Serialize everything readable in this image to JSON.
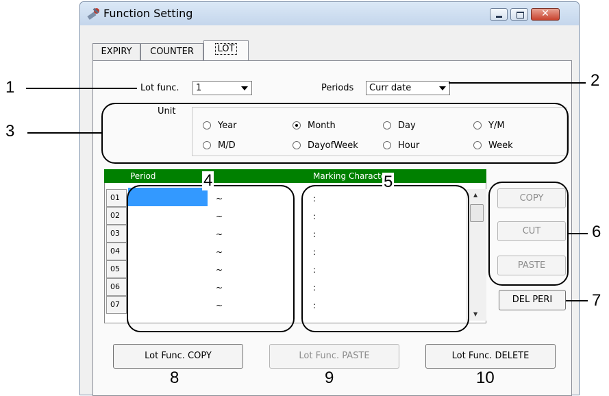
{
  "window": {
    "title": "Function Setting",
    "title_icon": "tools-icon",
    "minimize_icon": "minimize-icon",
    "maximize_icon": "maximize-icon",
    "close_icon": "close-icon",
    "close_glyph": "✕"
  },
  "tabs": [
    {
      "label": "EXPIRY"
    },
    {
      "label": "COUNTER"
    },
    {
      "label": "LOT",
      "active": true
    }
  ],
  "lot_func": {
    "label": "Lot func.",
    "value": "1"
  },
  "periods": {
    "label": "Periods",
    "value": "Curr date"
  },
  "unit": {
    "label": "Unit",
    "options": [
      {
        "label": "Year",
        "selected": false
      },
      {
        "label": "Month",
        "selected": true
      },
      {
        "label": "Day",
        "selected": false
      },
      {
        "label": "Y/M",
        "selected": false
      },
      {
        "label": "M/D",
        "selected": false
      },
      {
        "label": "DayofWeek",
        "selected": false
      },
      {
        "label": "Hour",
        "selected": false
      },
      {
        "label": "Week",
        "selected": false
      }
    ]
  },
  "grid": {
    "col_period": "Period",
    "col_marking": "Marking Characters",
    "rows": [
      "01",
      "02",
      "03",
      "04",
      "05",
      "06",
      "07"
    ],
    "tilde": "~",
    "colon": ":"
  },
  "side_buttons": {
    "copy": "COPY",
    "cut": "CUT",
    "paste": "PASTE",
    "del_peri": "DEL PERI"
  },
  "bottom_buttons": {
    "copy": "Lot Func. COPY",
    "paste": "Lot Func. PASTE",
    "delete": "Lot Func. DELETE"
  },
  "callouts": [
    "1",
    "2",
    "3",
    "4",
    "5",
    "6",
    "7",
    "8",
    "9",
    "10"
  ],
  "scroll": {
    "up_glyph": "▲",
    "down_glyph": "▼"
  },
  "colors": {
    "header_green": "#008000",
    "selection_blue": "#3399ff"
  }
}
